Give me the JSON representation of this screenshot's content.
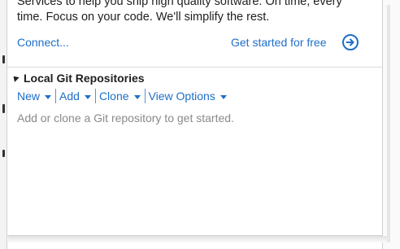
{
  "promo": {
    "line1": "Services to help you ship high quality software. On time, every",
    "line2": "time. Focus on your code. We'll simplify the rest."
  },
  "links": {
    "connect": "Connect...",
    "get_started": "Get started for free"
  },
  "section": {
    "title": "Local Git Repositories",
    "actions": [
      {
        "label": "New"
      },
      {
        "label": "Add"
      },
      {
        "label": "Clone"
      },
      {
        "label": "View Options"
      }
    ],
    "hint": "Add or clone a Git repository to get started."
  },
  "colors": {
    "link": "#1e6fc7",
    "hint": "#8a8a8a",
    "text": "#1e1e1e"
  }
}
